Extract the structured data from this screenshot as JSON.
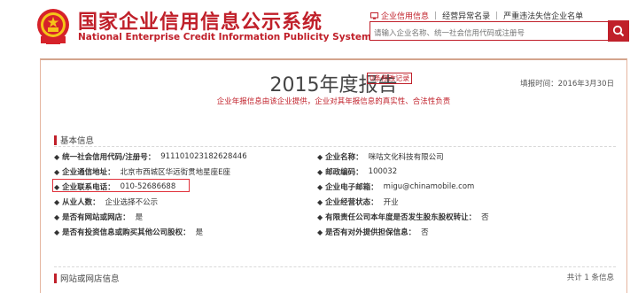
{
  "header": {
    "title_cn": "国家企业信用信息公示系统",
    "title_en": "National Enterprise Credit Information Publicity System",
    "nav": [
      {
        "label": "企业信用信息",
        "active": true
      },
      {
        "label": "经营异常名录",
        "active": false
      },
      {
        "label": "严重违法失信企业名单",
        "active": false
      }
    ],
    "search_placeholder": "请输入企业名称、统一社会信用代码或注册号"
  },
  "report": {
    "title": "2015年度报告",
    "modification_badge": "0条修改记录",
    "fill_date": "填报时间：2016年3月30日",
    "notice": "企业年报信息由该企业提供，企业对其年报信息的真实性、合法性负责",
    "basic_section_title": "基本信息",
    "fields": {
      "credit_code_label": "统一社会信用代码/注册号：",
      "credit_code_value": "911101023182628446",
      "company_name_label": "企业名称：",
      "company_name_value": "咪咕文化科技有限公司",
      "address_label": "企业通信地址：",
      "address_value": "北京市西城区华远街贯地星座E座",
      "postcode_label": "邮政编码：",
      "postcode_value": "100032",
      "phone_label": "企业联系电话：",
      "phone_value": "010-52686688",
      "email_label": "企业电子邮箱：",
      "email_value": "migu@chinamobile.com",
      "employees_label": "从业人数：",
      "employees_value": "企业选择不公示",
      "status_label": "企业经营状态：",
      "status_value": "开业",
      "website_label": "是否有网站或网店：",
      "website_value": "是",
      "equity_transfer_label": "有限责任公司本年度是否发生股东股权转让：",
      "equity_transfer_value": "否",
      "investment_label": "是否有投资信息或购买其他公司股权：",
      "investment_value": "是",
      "guarantee_label": "是否有对外提供担保信息：",
      "guarantee_value": "否"
    },
    "web_section_title": "网站或网店信息",
    "web_count": "共计 1 条信息"
  },
  "colors": {
    "brand_red": "#c0202a",
    "panel_border": "#e5b59f"
  }
}
